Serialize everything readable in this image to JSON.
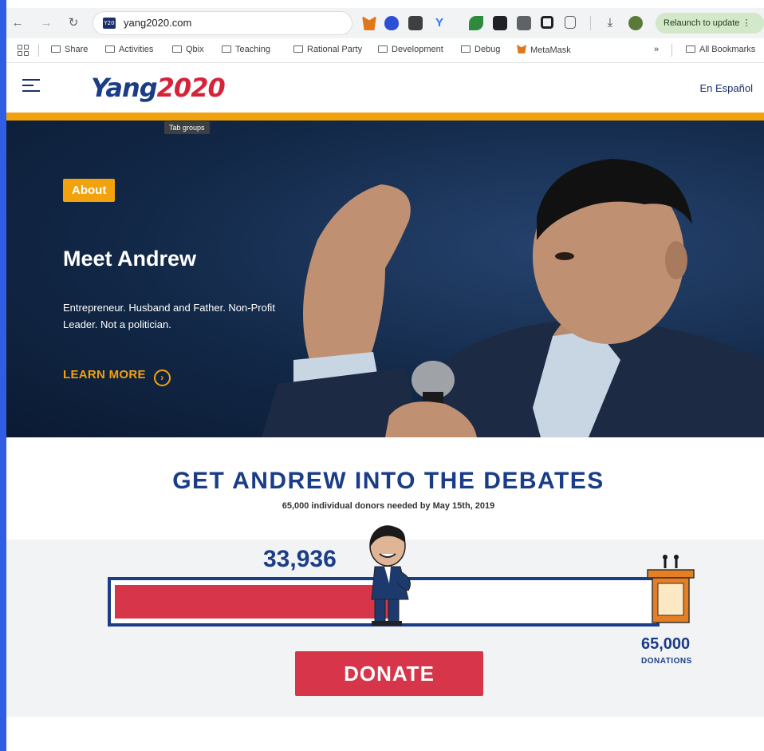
{
  "browser": {
    "url": "yang2020.com",
    "favicon_text": "Y20",
    "relaunch_label": "Relaunch to update",
    "tooltip": "Tab groups",
    "extensions": [
      "metamask-fox-icon",
      "shield-icon",
      "card-icon",
      "vpn-icon",
      "leaf-icon",
      "box-icon",
      "dark-icon",
      "square-icon",
      "puzzle-icon",
      "download-icon",
      "avatar-icon"
    ]
  },
  "bookmarks": {
    "items": [
      {
        "label": "Share",
        "icon": "folder"
      },
      {
        "label": "Activities",
        "icon": "folder"
      },
      {
        "label": "Qbix",
        "icon": "folder"
      },
      {
        "label": "Teaching",
        "icon": "folder"
      },
      {
        "label": "Rational Party",
        "icon": "folder"
      },
      {
        "label": "Development",
        "icon": "folder"
      },
      {
        "label": "Debug",
        "icon": "folder"
      },
      {
        "label": "MetaMask",
        "icon": "fox"
      }
    ],
    "overflow": "»",
    "all_bookmarks": "All Bookmarks"
  },
  "site": {
    "logo_left": "Yang",
    "logo_right": "2020",
    "language_link": "En Español"
  },
  "hero": {
    "badge": "About",
    "heading": "Meet Andrew",
    "tagline": "Entrepreneur. Husband and Father. Non-Profit Leader. Not a politician.",
    "cta": "LEARN MORE"
  },
  "debates": {
    "title": "GET ANDREW INTO THE DEBATES",
    "subtitle": "65,000 individual donors needed by May 15th, 2019",
    "current_count": "33,936",
    "goal_count": "65,000",
    "goal_label": "DONATIONS",
    "progress_fraction": 0.522,
    "donate_label": "DONATE"
  },
  "colors": {
    "navy": "#1b3c87",
    "red": "#d7364a",
    "gold": "#f2a20c"
  }
}
